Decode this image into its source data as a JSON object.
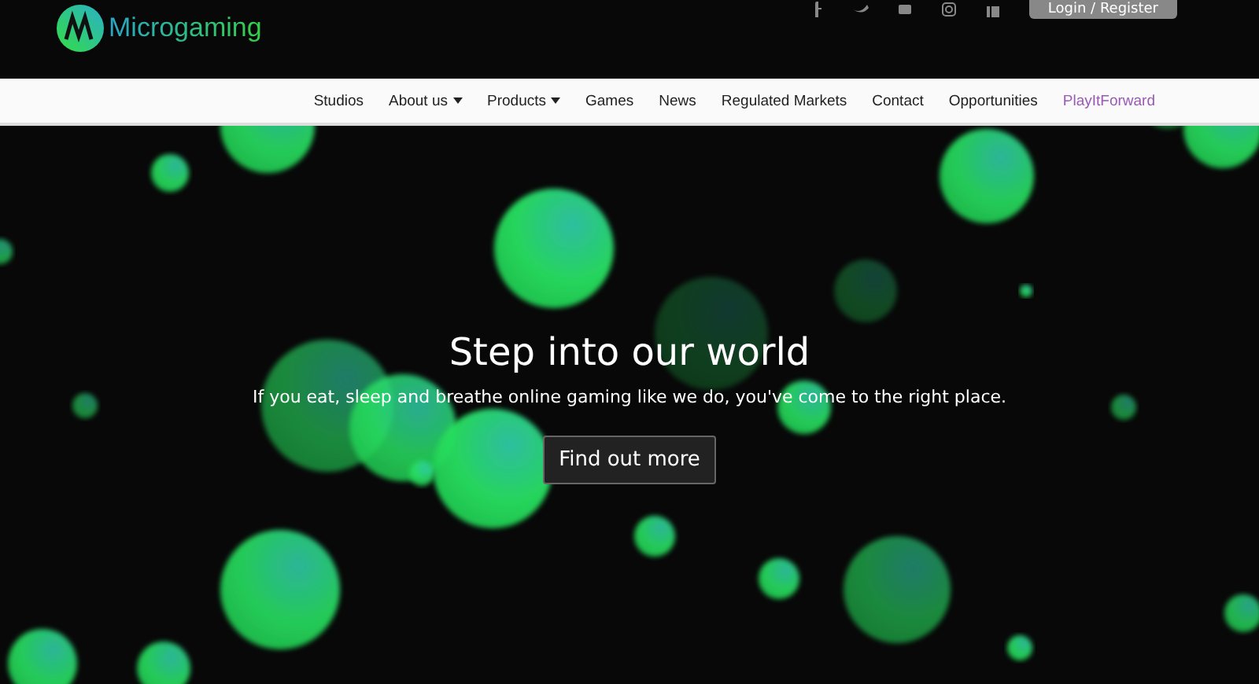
{
  "header": {
    "logo_text": "Microgaming",
    "login_button": "Login / Register"
  },
  "nav": [
    {
      "label": "Studios",
      "kind": "link",
      "color": "#222222"
    },
    {
      "label": "About us",
      "kind": "dropdown",
      "color": "#222222"
    },
    {
      "label": "Products",
      "kind": "dropdown",
      "color": "#222222"
    },
    {
      "label": "Games",
      "kind": "link",
      "color": "#222222"
    },
    {
      "label": "News",
      "kind": "link",
      "color": "#222222"
    },
    {
      "label": "Regulated Markets",
      "kind": "link",
      "color": "#222222"
    },
    {
      "label": "Contact",
      "kind": "link",
      "color": "#222222"
    },
    {
      "label": "Opportunities",
      "kind": "link",
      "color": "#222222"
    },
    {
      "label": "PlayItForward",
      "kind": "link",
      "color": "#9b59b6"
    }
  ],
  "hero": {
    "title": "Step into our world",
    "subtitle": "If you eat, sleep and breathe online gaming like we do, you've come to the right place.",
    "button": "Find out more"
  }
}
